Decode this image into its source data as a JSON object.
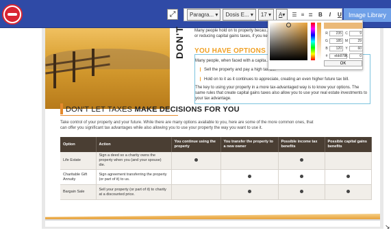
{
  "toolbar": {
    "paragraph": "Paragra...",
    "font": "Dosis E...",
    "size": "17",
    "image_library": "Image Library",
    "bold": "B",
    "italic": "I",
    "underline": "U",
    "clear": "I",
    "font_color": "A"
  },
  "document": {
    "vertical_heading": "DON'T",
    "top_copy_line1": "Many people hold on to property becau...",
    "top_copy_line2": "or reducing capital gains taxes, if you ke...",
    "options_heading_prefix": "YOU HAVE ",
    "options_heading_bold": "OPTIONS",
    "options_intro": "Many people, when faced with a capita...",
    "option1": "Sell the property and pay a high tax bill.",
    "option2": "Hold on to it as it continues to appreciate, creating an even higher future tax bill.",
    "key_text": "The key to using your property in a more tax-advantaged way is to know your options. The same rules that create capital gains taxes also allow you to use your real estate investments to your tax advantage.",
    "section_heading_prefix": "DON'T LET TAXES ",
    "section_heading_bold": "MAKE DECISIONS FOR YOU",
    "section_intro": "Take control of your property and your future. While there are many options available to you, here are some of the more common ones, that can offer you significant tax advantages while also allowing you to use your property the way you want to use it.",
    "table": {
      "headers": [
        "Option",
        "Action",
        "You continue using the property",
        "You transfer the property to a new owner",
        "Possible income tax benefits",
        "Possible capital gains benefits"
      ],
      "rows": [
        {
          "option": "Life Estate",
          "action": "Sign a deed so a charity owns the property when you (and your spouse) die.",
          "c1": true,
          "c2": false,
          "c3": true,
          "c4": false
        },
        {
          "option": "Charitable Gift Annuity",
          "action": "Sign agreement transferring the property (or part of it) to us.",
          "c1": false,
          "c2": true,
          "c3": true,
          "c4": true
        },
        {
          "option": "Bargain Sale",
          "action": "Sell your property (or part of it) to charity at a discounted price.",
          "c1": false,
          "c2": true,
          "c3": true,
          "c4": true
        }
      ]
    }
  },
  "color_picker": {
    "R": "235",
    "G": "185",
    "B": "120",
    "C": "9",
    "M": "29",
    "Y": "60",
    "K": "0",
    "hex": "ebb978",
    "ok": "OK",
    "swatch_color": "#ebb978"
  },
  "colors": {
    "topbar": "#2f4aa6",
    "accent": "#f0a023",
    "table_header": "#4a3e33"
  }
}
